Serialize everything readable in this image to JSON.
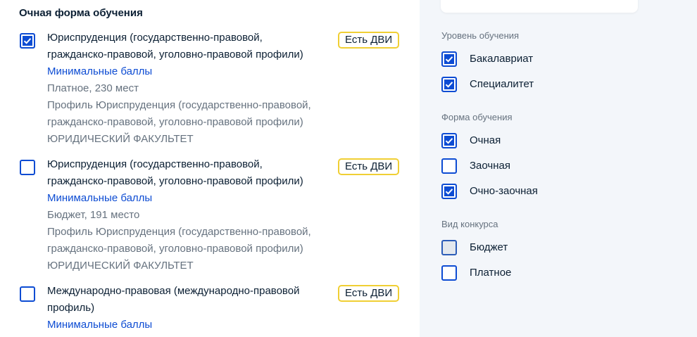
{
  "main": {
    "section_title": "Очная форма обучения",
    "programs": [
      {
        "checked": true,
        "title_lines": [
          "Юриспруденция (государственно-правовой,",
          "гражданско-правовой, уголовно-правовой профили)"
        ],
        "link": "Минимальные баллы",
        "funding": "Платное, 230 мест",
        "profile_lines": [
          "Профиль Юриспруденция (государственно-правовой,",
          "гражданско-правовой, уголовно-правовой профили)"
        ],
        "faculty": "ЮРИДИЧЕСКИЙ ФАКУЛЬТЕТ",
        "badge": "Есть ДВИ"
      },
      {
        "checked": false,
        "title_lines": [
          "Юриспруденция (государственно-правовой,",
          "гражданско-правовой, уголовно-правовой профили)"
        ],
        "link": "Минимальные баллы",
        "funding": "Бюджет, 191 место",
        "profile_lines": [
          "Профиль Юриспруденция (государственно-правовой,",
          "гражданско-правовой, уголовно-правовой профили)"
        ],
        "faculty": "ЮРИДИЧЕСКИЙ ФАКУЛЬТЕТ",
        "badge": "Есть ДВИ"
      },
      {
        "checked": false,
        "title_lines": [
          "Международно-правовая (международно-правовой",
          "профиль)"
        ],
        "link": "Минимальные баллы",
        "badge": "Есть ДВИ"
      }
    ]
  },
  "filters": {
    "level": {
      "label": "Уровень обучения",
      "options": [
        {
          "label": "Бакалавриат",
          "checked": true
        },
        {
          "label": "Специалитет",
          "checked": true
        }
      ]
    },
    "form": {
      "label": "Форма обучения",
      "options": [
        {
          "label": "Очная",
          "checked": true
        },
        {
          "label": "Заочная",
          "checked": false
        },
        {
          "label": "Очно-заочная",
          "checked": true
        }
      ]
    },
    "contest": {
      "label": "Вид конкурса",
      "options": [
        {
          "label": "Бюджет",
          "checked": false,
          "disabled": true
        },
        {
          "label": "Платное",
          "checked": false
        }
      ]
    }
  },
  "colors": {
    "accent": "#0d4cd3",
    "badge_border": "#f0cf34",
    "muted_text": "#66727f"
  }
}
